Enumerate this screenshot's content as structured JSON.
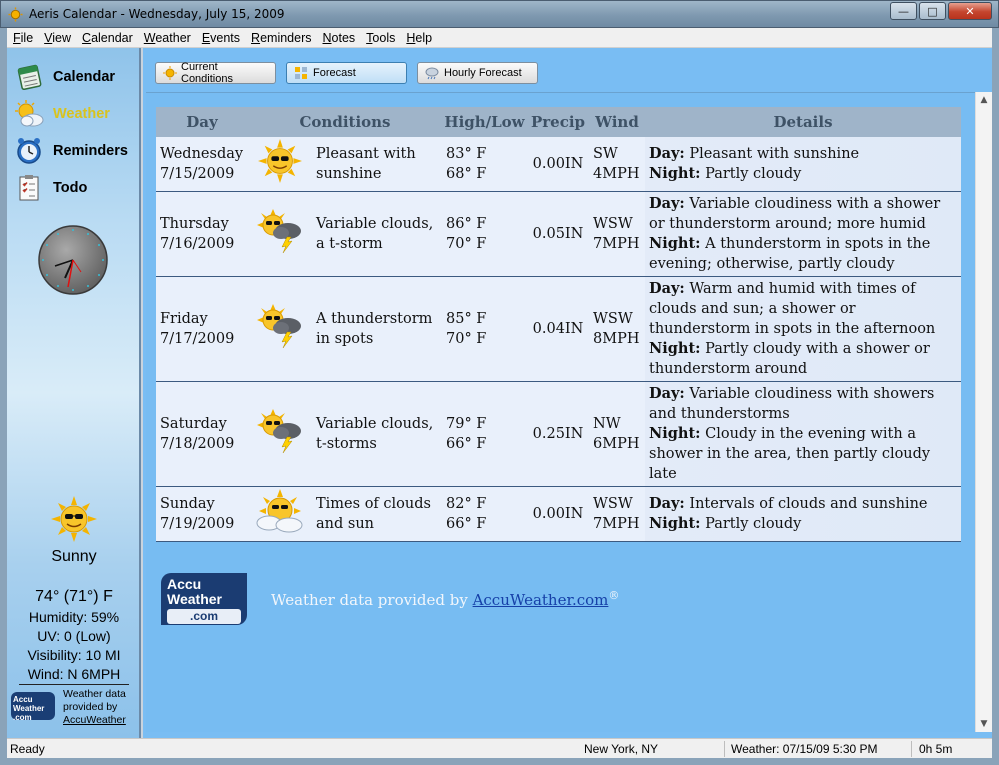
{
  "window": {
    "title": "Aeris Calendar - Wednesday, July 15, 2009",
    "minimize": "—",
    "maximize": "□",
    "close": "✕"
  },
  "menu": [
    "File",
    "View",
    "Calendar",
    "Weather",
    "Events",
    "Reminders",
    "Notes",
    "Tools",
    "Help"
  ],
  "sidebar": {
    "nav": [
      {
        "label": "Calendar",
        "icon": "calendar-icon",
        "active": false
      },
      {
        "label": "Weather",
        "icon": "weather-icon",
        "active": true
      },
      {
        "label": "Reminders",
        "icon": "alarm-clock-icon",
        "active": false
      },
      {
        "label": "Todo",
        "icon": "todo-list-icon",
        "active": false
      }
    ],
    "current": {
      "condition": "Sunny",
      "temp": "74° (71°) F",
      "humidity": "Humidity: 59%",
      "uv": "UV: 0 (Low)",
      "visibility": "Visibility: 10 MI",
      "wind": "Wind: N 6MPH"
    },
    "credit": {
      "logo_l1": "Accu",
      "logo_l2": "Weather",
      "logo_l3": ".com",
      "line1": "Weather data",
      "line2": "provided by",
      "link": "AccuWeather"
    }
  },
  "toolbar": {
    "current_conditions": "Current Conditions",
    "forecast": "Forecast",
    "hourly_forecast": "Hourly Forecast"
  },
  "forecast": {
    "headers": {
      "day": "Day",
      "conditions": "Conditions",
      "hilo": "High/Low",
      "precip": "Precip",
      "wind": "Wind",
      "details": "Details"
    },
    "rows": [
      {
        "weekday": "Wednesday",
        "date": "7/15/2009",
        "icon": "sunny-icon",
        "cond": "Pleasant with sunshine",
        "high": "83° F",
        "low": "68° F",
        "precip": "0.00IN",
        "wind_dir": "SW",
        "wind_speed": "4MPH",
        "day_label": "Day:",
        "day_text": "Pleasant with sunshine",
        "night_label": "Night:",
        "night_text": "Partly cloudy"
      },
      {
        "weekday": "Thursday",
        "date": "7/16/2009",
        "icon": "tstorm-sun-icon",
        "cond": "Variable clouds, a t-storm",
        "high": "86° F",
        "low": "70° F",
        "precip": "0.05IN",
        "wind_dir": "WSW",
        "wind_speed": "7MPH",
        "day_label": "Day:",
        "day_text": "Variable cloudiness with a shower or thunderstorm around; more humid",
        "night_label": "Night:",
        "night_text": "A thunderstorm in spots in the evening; otherwise, partly cloudy"
      },
      {
        "weekday": "Friday",
        "date": "7/17/2009",
        "icon": "tstorm-sun-icon",
        "cond": "A thunderstorm in spots",
        "high": "85° F",
        "low": "70° F",
        "precip": "0.04IN",
        "wind_dir": "WSW",
        "wind_speed": "8MPH",
        "day_label": "Day:",
        "day_text": "Warm and humid with times of clouds and sun; a shower or thunderstorm in spots in the afternoon",
        "night_label": "Night:",
        "night_text": "Partly cloudy with a shower or thunderstorm around"
      },
      {
        "weekday": "Saturday",
        "date": "7/18/2009",
        "icon": "tstorm-sun-icon",
        "cond": "Variable clouds, t-storms",
        "high": "79° F",
        "low": "66° F",
        "precip": "0.25IN",
        "wind_dir": "NW",
        "wind_speed": "6MPH",
        "day_label": "Day:",
        "day_text": "Variable cloudiness with showers and thunderstorms",
        "night_label": "Night:",
        "night_text": "Cloudy in the evening with a shower in the area, then partly cloudy late"
      },
      {
        "weekday": "Sunday",
        "date": "7/19/2009",
        "icon": "partly-cloudy-icon",
        "cond": "Times of clouds and sun",
        "high": "82° F",
        "low": "66° F",
        "precip": "0.00IN",
        "wind_dir": "WSW",
        "wind_speed": "7MPH",
        "day_label": "Day:",
        "day_text": "Intervals of clouds and sunshine",
        "night_label": "Night:",
        "night_text": "Partly cloudy"
      }
    ]
  },
  "footer": {
    "logo_l1": "Accu",
    "logo_l2": "Weather",
    "logo_l3": ".com",
    "text": "Weather data provided by ",
    "link": "AccuWeather.com",
    "reg": "®"
  },
  "status": {
    "ready": "Ready",
    "location": "New York, NY",
    "weather_time": "Weather: 07/15/09 5:30 PM",
    "elapsed": "0h 5m"
  }
}
